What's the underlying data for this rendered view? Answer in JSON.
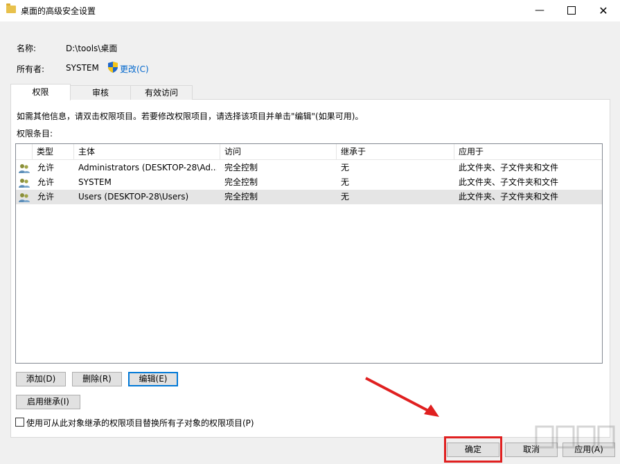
{
  "window": {
    "title": "桌面的高级安全设置",
    "minimize_glyph": "—",
    "close_glyph": "✕"
  },
  "fields": {
    "name_label": "名称:",
    "name_value": "D:\\tools\\桌面",
    "owner_label": "所有者:",
    "owner_value": "SYSTEM",
    "change_link": "更改(C)"
  },
  "tabs": [
    {
      "label": "权限",
      "active": true
    },
    {
      "label": "审核",
      "active": false
    },
    {
      "label": "有效访问",
      "active": false
    }
  ],
  "info_text": "如需其他信息，请双击权限项目。若要修改权限项目，请选择该项目并单击\"编辑\"(如果可用)。",
  "permissions_label": "权限条目:",
  "table": {
    "columns": [
      "类型",
      "主体",
      "访问",
      "继承于",
      "应用于"
    ],
    "rows": [
      {
        "type": "允许",
        "principal": "Administrators (DESKTOP-28\\Ad...",
        "access": "完全控制",
        "inherited": "无",
        "applies": "此文件夹、子文件夹和文件"
      },
      {
        "type": "允许",
        "principal": "SYSTEM",
        "access": "完全控制",
        "inherited": "无",
        "applies": "此文件夹、子文件夹和文件"
      },
      {
        "type": "允许",
        "principal": "Users (DESKTOP-28\\Users)",
        "access": "完全控制",
        "inherited": "无",
        "applies": "此文件夹、子文件夹和文件"
      }
    ]
  },
  "buttons": {
    "add": "添加(D)",
    "remove": "删除(R)",
    "edit": "编辑(E)",
    "enable_inheritance": "启用继承(I)",
    "ok": "确定",
    "cancel": "取消",
    "apply": "应用(A)"
  },
  "replace_checkbox_label": "使用可从此对象继承的权限项目替换所有子对象的权限项目(P)",
  "colors": {
    "highlight": "#e02020",
    "link": "#0066cc",
    "selection": "#e5e5e5"
  }
}
